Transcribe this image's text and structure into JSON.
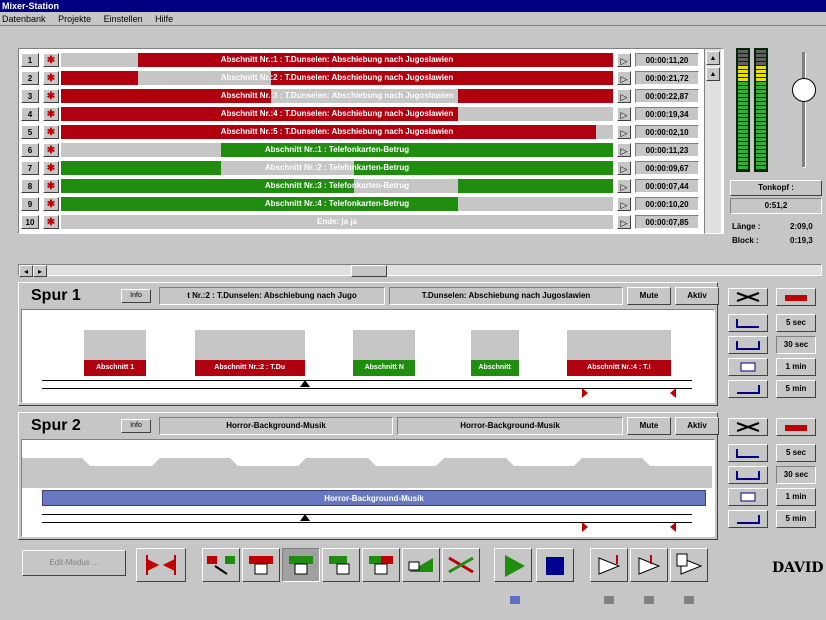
{
  "window": {
    "title": "Mixer-Station"
  },
  "menu": [
    "Datenbank",
    "Projekte",
    "Einstellen",
    "Hilfe"
  ],
  "clips": [
    {
      "num": "1",
      "label": "Abschnitt Nr.:1 : T.Dunselen: Abschiebung nach Jugoslawien",
      "color": "#b00010",
      "fill_start": 0.14,
      "fill_end": 1.0,
      "time": "00:00:11,20"
    },
    {
      "num": "2",
      "label": "Abschnitt Nr.:2 : T.Dunselen: Abschiebung nach Jugoslawien",
      "color": "#b00010",
      "fill_start": 0.0,
      "fill_end": 1.0,
      "gap_start": 0.14,
      "gap_end": 0.38,
      "time": "00:00:21,72"
    },
    {
      "num": "3",
      "label": "Abschnitt Nr.:3 : T.Dunselen: Abschiebung nach Jugoslawien",
      "color": "#b00010",
      "fill_start": 0.0,
      "fill_end": 0.38,
      "fill2_start": 0.72,
      "fill2_end": 1.0,
      "time": "00:00:22,87"
    },
    {
      "num": "4",
      "label": "Abschnitt Nr.:4 : T.Dunselen: Abschiebung nach Jugoslawien",
      "color": "#b00010",
      "fill_start": 0.0,
      "fill_end": 0.72,
      "fill2_start": 0.72,
      "fill2_end": 0.97,
      "gap_start": 0.72,
      "gap_end": 0.97,
      "time": "00:00:19,34"
    },
    {
      "num": "5",
      "label": "Abschnitt Nr.:5 : T.Dunselen: Abschiebung nach Jugoslawien",
      "color": "#b00010",
      "fill_start": 0.0,
      "fill_end": 0.97,
      "time": "00:00:02,10"
    },
    {
      "num": "6",
      "label": "Abschnitt Nr.:1 : Telefonkarten-Betrug",
      "color": "#208c10",
      "fill_start": 0.29,
      "fill_end": 1.0,
      "time": "00:00:11,23"
    },
    {
      "num": "7",
      "label": "Abschnitt Nr.:2 : Telefonkarten-Betrug",
      "color": "#208c10",
      "fill_start": 0.0,
      "fill_end": 0.29,
      "fill2_start": 0.53,
      "fill2_end": 1.0,
      "time": "00:00:09,67"
    },
    {
      "num": "8",
      "label": "Abschnitt Nr.:3 : Telefonkarten-Betrug",
      "color": "#208c10",
      "fill_start": 0.0,
      "fill_end": 0.53,
      "fill2_start": 0.72,
      "fill2_end": 1.0,
      "time": "00:00:07,44"
    },
    {
      "num": "9",
      "label": "Abschnitt Nr.:4 : Telefonkarten-Betrug",
      "color": "#208c10",
      "fill_start": 0.0,
      "fill_end": 0.72,
      "time": "00:00:10,20"
    },
    {
      "num": "10",
      "label": "Ende: ja ja",
      "color": "#c6c6c6",
      "fill_start": 0.0,
      "fill_end": 0.0,
      "time": "00:00:07,85"
    }
  ],
  "side_info": {
    "tonkopf_label": "Tonkopf :",
    "tonkopf_value": "0:51,2",
    "laenge_label": "Länge :",
    "laenge_value": "2:09,0",
    "block_label": "Block :",
    "block_value": "0:19,3"
  },
  "spur1": {
    "title": "Spur 1",
    "info": "Info",
    "name_left": "t Nr.:2 : T.Dunselen: Abschiebung nach Jugo",
    "name_right": "T.Dunselen: Abschiebung nach Jugoslawien",
    "mute": "Mute",
    "aktiv": "Aktiv",
    "clips": [
      {
        "label": "Abschnitt 1",
        "color": "#b00010",
        "start": 0.09,
        "width": 0.09
      },
      {
        "label": "Abschnitt Nr.:2 : T.Du",
        "color": "#b00010",
        "start": 0.25,
        "width": 0.16
      },
      {
        "label": "Abschnitt N",
        "color": "#208c10",
        "start": 0.48,
        "width": 0.09
      },
      {
        "label": "Abschnitt",
        "color": "#208c10",
        "start": 0.65,
        "width": 0.07
      },
      {
        "label": "Abschnitt Nr.:4 : T.I",
        "color": "#b00010",
        "start": 0.79,
        "width": 0.15
      }
    ]
  },
  "spur2": {
    "title": "Spur 2",
    "info": "Info",
    "name_left": "Horror-Background-Musik",
    "name_right": "Horror-Background-Musik",
    "mute": "Mute",
    "aktiv": "Aktiv",
    "band_label": "Horror-Background-Musik",
    "band_color": "#6878c0"
  },
  "zoom": [
    "5 sec",
    "30 sec",
    "1 min",
    "5 min"
  ],
  "bottom": {
    "edit_label": "Edit-Modus ...",
    "logo": "DAVID"
  },
  "colors": {
    "red": "#b00010",
    "green": "#208c10",
    "blue": "#000090",
    "panel": "#c6c6c6"
  }
}
